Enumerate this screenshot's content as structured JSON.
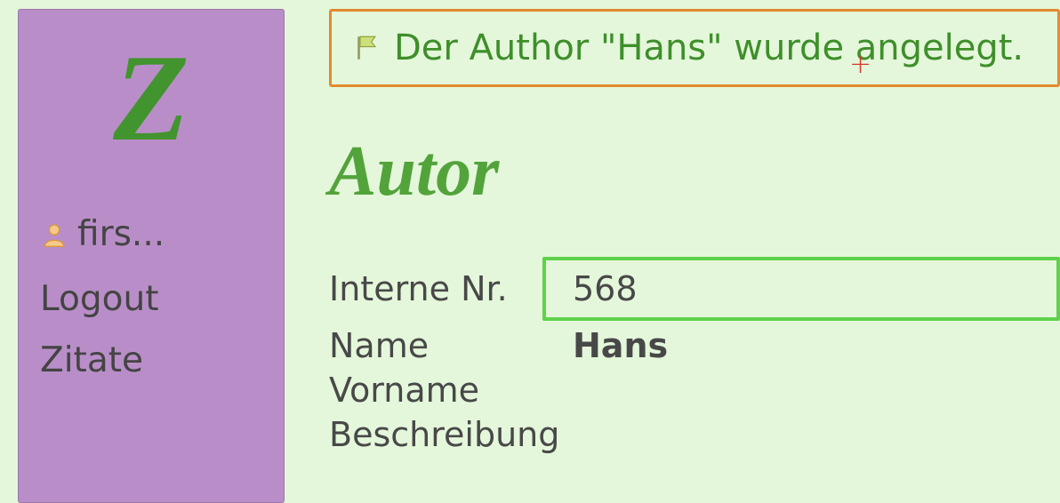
{
  "sidebar": {
    "logo_text": "Z",
    "user_label": "firs...",
    "links": {
      "logout": "Logout",
      "zitate": "Zitate"
    }
  },
  "flash": {
    "message": "Der Author \"Hans\" wurde angelegt."
  },
  "page": {
    "title": "Autor"
  },
  "author": {
    "labels": {
      "interne_nr": "Interne Nr.",
      "name": "Name",
      "vorname": "Vorname",
      "beschreibung": "Beschreibung"
    },
    "values": {
      "interne_nr": "568",
      "name": "Hans",
      "vorname": "",
      "beschreibung": ""
    }
  }
}
